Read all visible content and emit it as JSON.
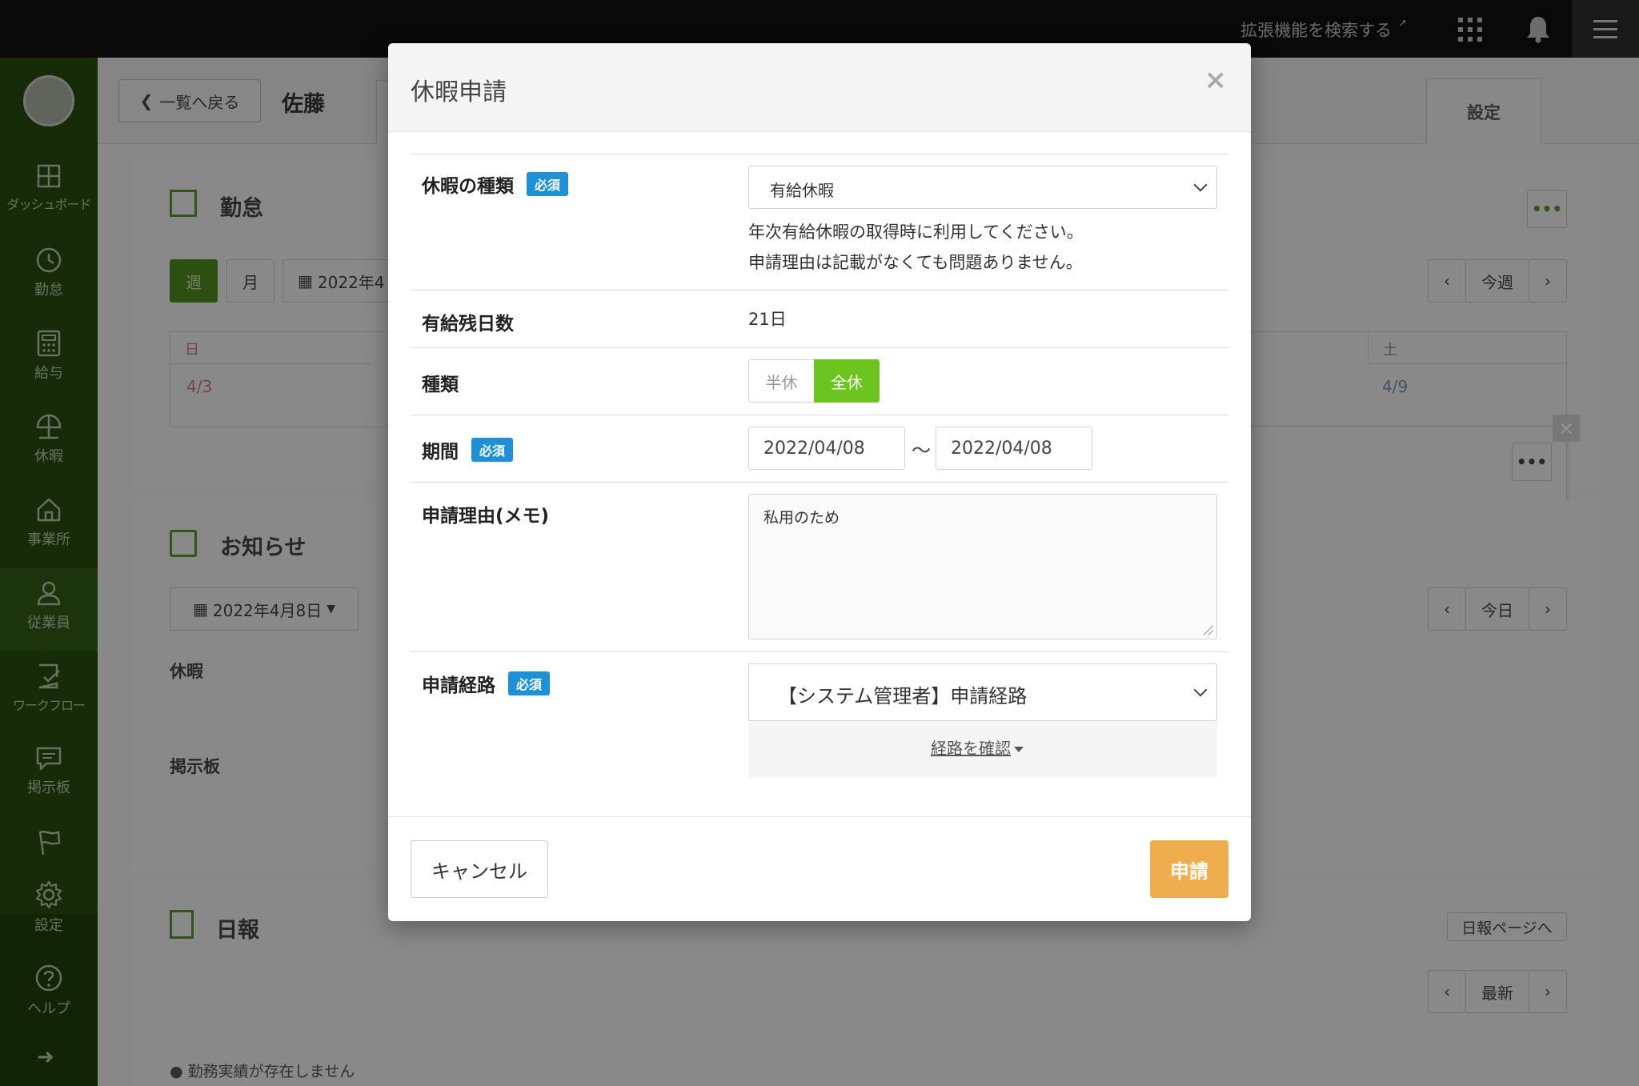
{
  "topbar": {
    "extension_search": "拡張機能を検索する",
    "extension_search_icon": "external-link-icon",
    "apps_icon": "grid-icon",
    "notifications_icon": "bell-icon",
    "menu_icon": "hamburger-icon"
  },
  "sidebar": {
    "items": [
      {
        "label": "ダッシュボード",
        "icon": "dashboard-icon"
      },
      {
        "label": "勤怠",
        "icon": "clock-icon"
      },
      {
        "label": "給与",
        "icon": "calculator-icon"
      },
      {
        "label": "休暇",
        "icon": "umbrella-icon"
      },
      {
        "label": "事業所",
        "icon": "home-icon"
      },
      {
        "label": "従業員",
        "icon": "person-icon"
      },
      {
        "label": "ワークフロー",
        "icon": "checklist-icon"
      },
      {
        "label": "掲示板",
        "icon": "chat-icon"
      },
      {
        "label": "",
        "icon": "flag-icon"
      },
      {
        "label": "設定",
        "icon": "gear-icon"
      },
      {
        "label": "ヘルプ",
        "icon": "help-icon"
      }
    ],
    "expand_icon": "arrow-right-icon"
  },
  "background": {
    "back_button": "一覧へ戻る",
    "employee_name": "佐藤",
    "settings_tab": "設定",
    "attendance": {
      "title": "勤怠",
      "view_week": "週",
      "view_month": "月",
      "date_partial": "2022年4",
      "prev": "‹",
      "current_week": "今週",
      "next": "›",
      "sunday": "日",
      "saturday": "土",
      "date_sun": "4/3",
      "date_sat": "4/9",
      "more": "•••"
    },
    "news": {
      "title": "お知らせ",
      "date": "2022年4月8日",
      "prev": "‹",
      "today": "今日",
      "next": "›",
      "leave_label": "休暇",
      "board_label": "掲示板"
    },
    "daily_report": {
      "title": "日報",
      "page_link": "日報ページへ",
      "prev": "‹",
      "latest": "最新",
      "next": "›",
      "empty_note": "勤務実績が存在しません"
    }
  },
  "modal": {
    "title": "休暇申請",
    "close": "×",
    "required_badge": "必須",
    "leave_type": {
      "label": "休暇の種類",
      "selected": "有給休暇",
      "help_line1": "年次有給休暇の取得時に利用してください。",
      "help_line2": "申請理由は記載がなくても問題ありません。"
    },
    "remaining": {
      "label": "有給残日数",
      "value": "21日"
    },
    "kind": {
      "label": "種類",
      "half": "半休",
      "full": "全休",
      "selected": "全休"
    },
    "period": {
      "label": "期間",
      "start": "2022/04/08",
      "separator": "〜",
      "end": "2022/04/08"
    },
    "reason": {
      "label": "申請理由(メモ)",
      "value": "私用のため"
    },
    "route": {
      "label": "申請経路",
      "selected": "【システム管理者】申請経路",
      "confirm_link": "経路を確認"
    },
    "footer": {
      "cancel": "キャンセル",
      "submit": "申請"
    },
    "colors": {
      "accent_green": "#6cc51f",
      "required_blue": "#1f8fd6",
      "submit_orange": "#f0ad4e"
    }
  }
}
